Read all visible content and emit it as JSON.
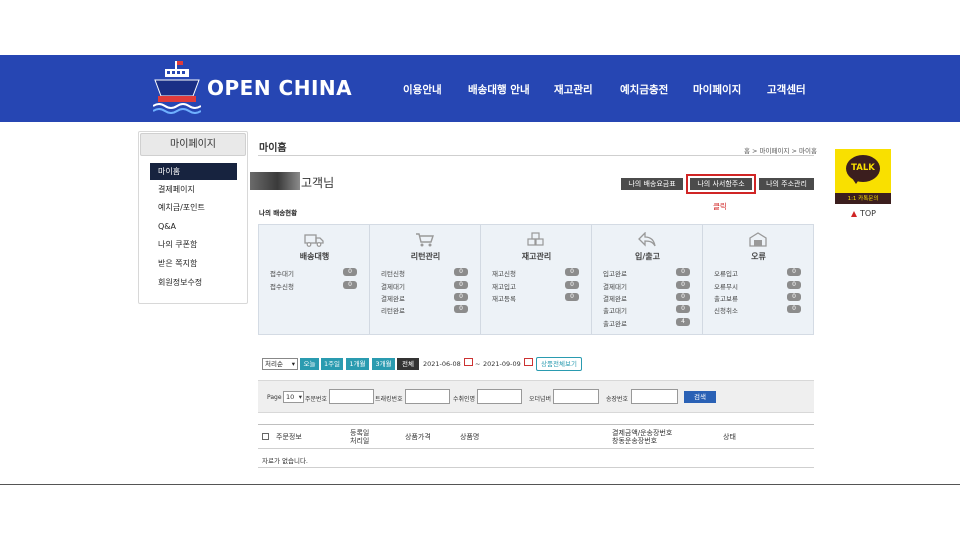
{
  "header": {
    "logo_text": "OPEN CHINA",
    "nav": [
      "이용안내",
      "배송대행 안내",
      "재고관리",
      "예치금충전",
      "마이페이지",
      "고객센터"
    ]
  },
  "sidebar": {
    "title": "마이페이지",
    "items": [
      "마이홈",
      "결제페이지",
      "예치금/포인트",
      "Q&A",
      "나의 쿠폰함",
      "받은 쪽지함",
      "회원정보수정"
    ]
  },
  "main": {
    "title": "마이홈",
    "breadcrumb": "홈 > 마이페이지 > 마이홈",
    "customer_suffix": "고객님",
    "buttons": [
      "나의 배송요금표",
      "나의 사서함주소",
      "나의 주소관리"
    ],
    "click_note": "클릭",
    "status_heading": "나의 배송현황"
  },
  "status": [
    {
      "title": "배송대행",
      "icon": "truck-icon",
      "rows": [
        [
          "접수대기",
          "0"
        ],
        [
          "접수신청",
          "0"
        ]
      ]
    },
    {
      "title": "리턴관리",
      "icon": "cart-icon",
      "rows": [
        [
          "리턴신청",
          "0"
        ],
        [
          "결제대기",
          "0"
        ],
        [
          "결제완료",
          "0"
        ],
        [
          "리턴완료",
          "0"
        ]
      ]
    },
    {
      "title": "재고관리",
      "icon": "boxes-icon",
      "rows": [
        [
          "재고신청",
          "0"
        ],
        [
          "재고입고",
          "0"
        ],
        [
          "재고등록",
          "0"
        ]
      ]
    },
    {
      "title": "입/출고",
      "icon": "return-arrow-icon",
      "rows": [
        [
          "입고완료",
          "0"
        ],
        [
          "결제대기",
          "0"
        ],
        [
          "결제완료",
          "0"
        ],
        [
          "출고대기",
          "0"
        ],
        [
          "출고완료",
          "4"
        ]
      ]
    },
    {
      "title": "오류",
      "icon": "warehouse-icon",
      "rows": [
        [
          "오류입고",
          "0"
        ],
        [
          "오류무시",
          "0"
        ],
        [
          "출고보류",
          "0"
        ],
        [
          "신청취소",
          "0"
        ]
      ]
    }
  ],
  "filter": {
    "sort": "처리순",
    "periods": [
      "오늘",
      "1주일",
      "1개월",
      "3개월",
      "전체"
    ],
    "date_from": "2021-06-08",
    "tilde": "~",
    "date_to": "2021-09-09",
    "detail": "상품전체보기"
  },
  "search": {
    "page_label": "Page",
    "page_size": "10",
    "labels": [
      "주문번호",
      "트래킹번호",
      "수취인명",
      "오더넘버",
      "송장번호"
    ],
    "button": "검색"
  },
  "table": {
    "headers": [
      "주문정보",
      "등록일\n처리일",
      "상품가격",
      "상품명",
      "결제금액/운송장번호\n창동운송장번호",
      "상태"
    ],
    "empty": "자료가 없습니다."
  },
  "kakao": {
    "bubble": "TALK",
    "label": "1:1 카톡문의",
    "top": "TOP"
  },
  "colors": {
    "header": "#2646b3",
    "active_side": "#17233f",
    "teal": "#2a9bb0",
    "highlight": "#d02525"
  }
}
